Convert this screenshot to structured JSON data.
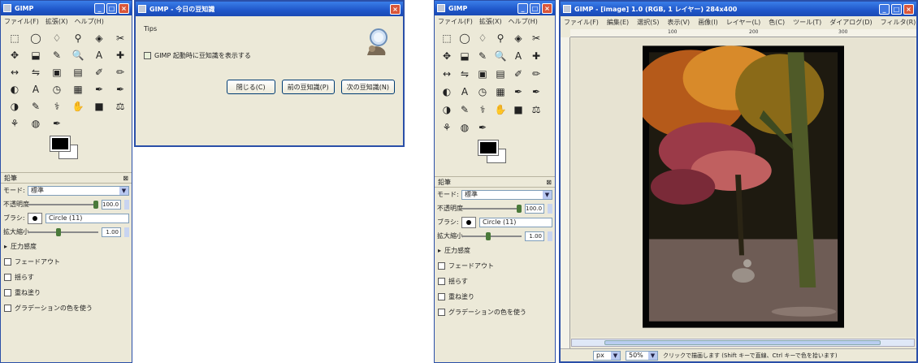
{
  "toolbox": {
    "title": "GIMP",
    "menu": [
      "ファイル(F)",
      "拡張(X)",
      "ヘルプ(H)"
    ],
    "icons": [
      "rect-select-icon",
      "ellipse-select-icon",
      "free-select-icon",
      "fuzzy-select-icon",
      "color-select-icon",
      "scissors-icon",
      "move-icon",
      "crop-icon",
      "color-picker-icon",
      "zoom-icon",
      "text-icon",
      "align-icon",
      "transform-icon",
      "flip-icon",
      "bucket-icon",
      "gradient-icon",
      "pencil-icon",
      "brush-icon",
      "tool-icon",
      "text-tool-icon",
      "clock-icon",
      "rect-icon",
      "pencil2-icon",
      "airbrush-icon",
      "eraser-icon",
      "clone-icon",
      "heal-icon",
      "smudge-icon",
      "sponge-icon",
      "measure-icon",
      "path-icon",
      "dodge-icon",
      "ink-icon"
    ],
    "glyphs": [
      "⬚",
      "◯",
      "♢",
      "⚲",
      "◈",
      "✂",
      "✥",
      "⬓",
      "✎",
      "🔍",
      "A",
      "✚",
      "↔",
      "⇋",
      "▣",
      "▤",
      "✐",
      "✏",
      "◐",
      "A",
      "◷",
      "▦",
      "✒",
      "✒",
      "◑",
      "✎",
      "⚕",
      "✋",
      "■",
      "⚖",
      "⚘",
      "◍",
      "✒"
    ]
  },
  "tool_options": {
    "title": "鉛筆",
    "mode_label": "モード:",
    "mode_value": "標準",
    "opacity_label": "不透明度",
    "opacity_value": "100.0",
    "brush_label": "ブラシ:",
    "brush_value": "Circle (11)",
    "scale_label": "拡大縮小",
    "scale_value": "1.00",
    "pressure_label": "圧力感度",
    "fade_label": "フェードアウト",
    "jitter_label": "揺らす",
    "incremental_label": "重ね塗り",
    "gradient_label": "グラデーションの色を使う"
  },
  "dialog": {
    "title": "GIMP - 今日の豆知識",
    "message": "Tips",
    "checkbox_label": "GIMP 起動時に豆知識を表示する",
    "buttons": [
      "閉じる(C)",
      "前の豆知識(P)",
      "次の豆知識(N)"
    ]
  },
  "image_window": {
    "title": "GIMP - [image] 1.0 (RGB, 1 レイヤー) 284x400",
    "menu": [
      "ファイル(F)",
      "編集(E)",
      "選択(S)",
      "表示(V)",
      "画像(I)",
      "レイヤー(L)",
      "色(C)",
      "ツール(T)",
      "ダイアログ(D)",
      "フィルタ(R)"
    ],
    "ruler_marks": [
      "100",
      "200",
      "300"
    ],
    "zoom_unit": "px",
    "zoom_value": "50%",
    "status_text": "クリックで描画します (Shift キーで直線、Ctrl キーで色を拾います)"
  },
  "colors": {
    "xp_title": "#1f56c9",
    "panel": "#ece9d8",
    "close": "#d9563a"
  }
}
